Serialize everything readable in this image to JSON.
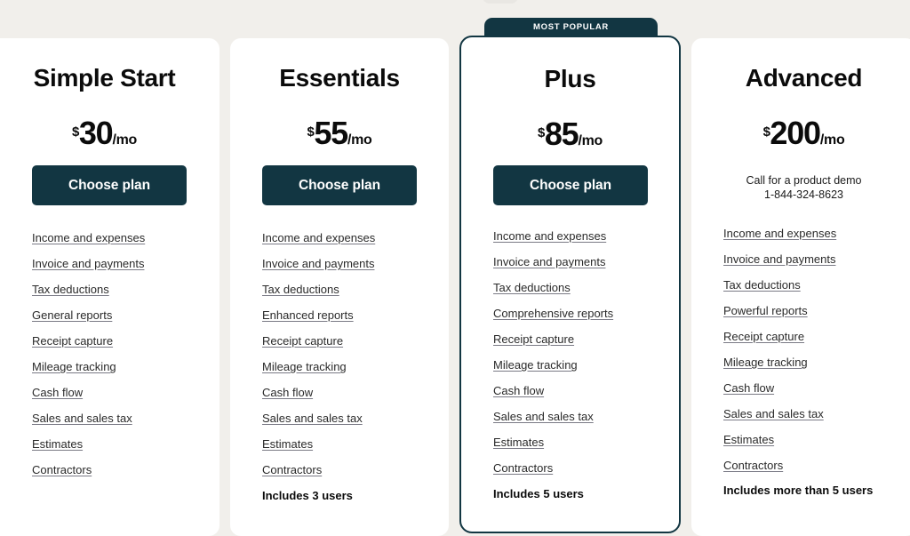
{
  "page": {
    "background_color": "#f1efeb",
    "accent_color": "#123642",
    "card_background": "#ffffff"
  },
  "badge": {
    "label": "MOST POPULAR"
  },
  "plans": [
    {
      "name": "Simple Start",
      "currency": "$",
      "amount": "30",
      "period": "/mo",
      "cta_label": "Choose plan",
      "features": [
        "Income and expenses",
        "Invoice and payments",
        "Tax deductions",
        "General reports",
        "Receipt capture",
        "Mileage tracking",
        "Cash flow",
        "Sales and sales tax",
        "Estimates",
        "Contractors"
      ],
      "users_note": ""
    },
    {
      "name": "Essentials",
      "currency": "$",
      "amount": "55",
      "period": "/mo",
      "cta_label": "Choose plan",
      "features": [
        "Income and expenses",
        "Invoice and payments",
        "Tax deductions",
        "Enhanced reports",
        "Receipt capture",
        "Mileage tracking",
        "Cash flow",
        "Sales and sales tax",
        "Estimates",
        "Contractors"
      ],
      "users_note": "Includes 3 users"
    },
    {
      "name": "Plus",
      "currency": "$",
      "amount": "85",
      "period": "/mo",
      "cta_label": "Choose plan",
      "features": [
        "Income and expenses",
        "Invoice and payments",
        "Tax deductions",
        "Comprehensive reports",
        "Receipt capture",
        "Mileage tracking",
        "Cash flow",
        "Sales and sales tax",
        "Estimates",
        "Contractors"
      ],
      "users_note": "Includes 5 users"
    },
    {
      "name": "Advanced",
      "currency": "$",
      "amount": "200",
      "period": "/mo",
      "demo_line_1": "Call for a product demo",
      "demo_line_2": "1-844-324-8623",
      "features": [
        "Income and expenses",
        "Invoice and payments",
        "Tax deductions",
        "Powerful reports",
        "Receipt capture",
        "Mileage tracking",
        "Cash flow",
        "Sales and sales tax",
        "Estimates",
        "Contractors"
      ],
      "users_note": "Includes more than 5 users"
    }
  ]
}
